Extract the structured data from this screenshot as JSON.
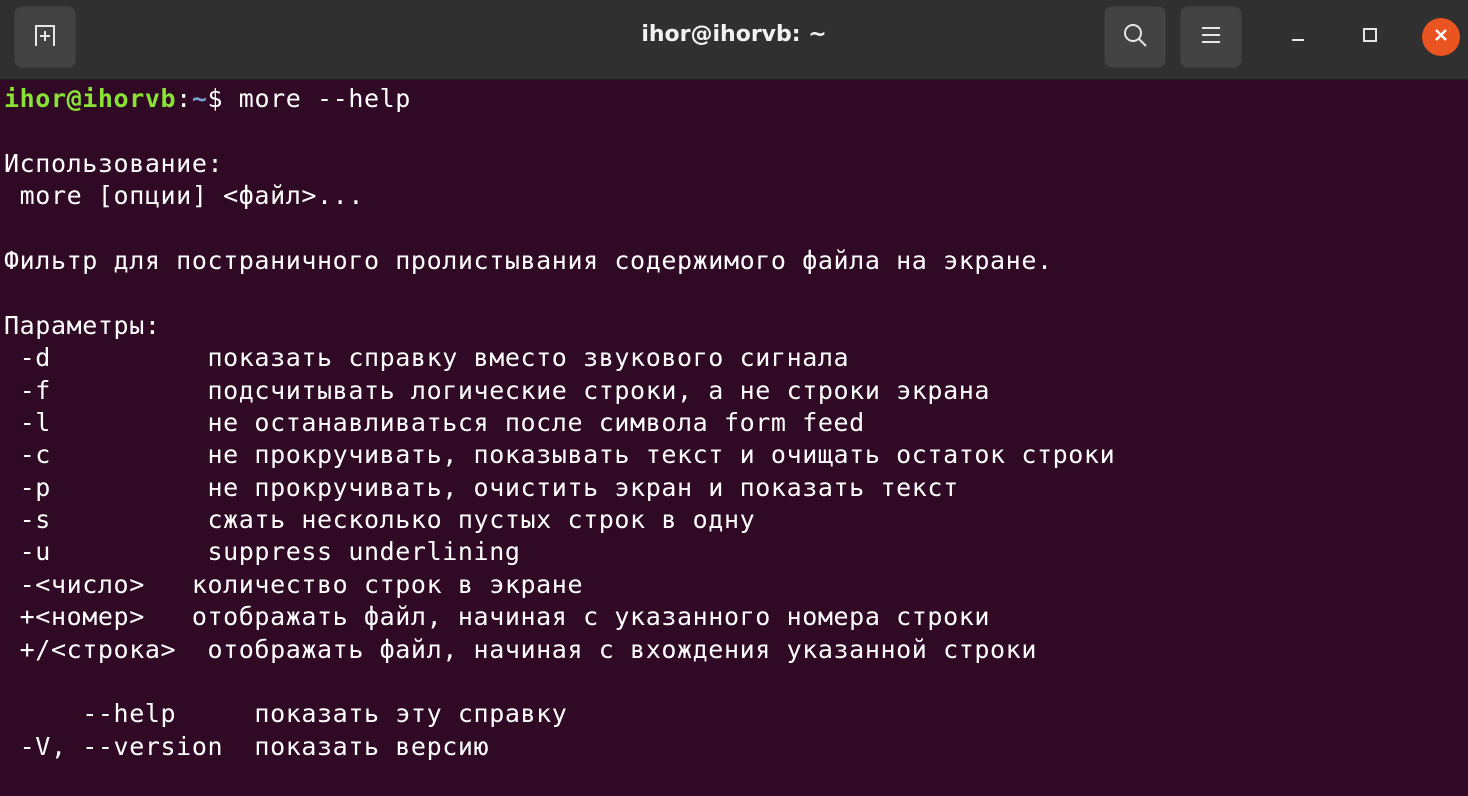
{
  "window": {
    "title": "ihor@ihorvb: ~",
    "icons": {
      "new_tab": "new-tab-icon",
      "search": "search-icon",
      "menu": "hamburger-menu-icon",
      "minimize": "minimize-icon",
      "maximize": "maximize-icon",
      "close": "close-icon"
    },
    "colors": {
      "titlebar": "#303030",
      "terminal_bg": "#300a24",
      "prompt_user": "#8ae234",
      "prompt_path": "#729fcf",
      "close_button": "#e95420"
    }
  },
  "terminal": {
    "prompt": {
      "user": "ihor@ihorvb",
      "separator": ":",
      "path": "~",
      "symbol": "$ ",
      "command": "more --help"
    },
    "lines": [
      "",
      "Использование:",
      " more [опции] <файл>...",
      "",
      "Фильтр для постраничного пролистывания содержимого файла на экране.",
      "",
      "Параметры:",
      " -d          показать справку вместо звукового сигнала",
      " -f          подсчитывать логические строки, а не строки экрана",
      " -l          не останавливаться после символа form feed",
      " -c          не прокручивать, показывать текст и очищать остаток строки",
      " -p          не прокручивать, очистить экран и показать текст",
      " -s          сжать несколько пустых строк в одну",
      " -u          suppress underlining",
      " -<число>   количество строк в экране",
      " +<номер>   отображать файл, начиная с указанного номера строки",
      " +/<строка>  отображать файл, начиная с вхождения указанной строки",
      "",
      "     --help     показать эту справку",
      " -V, --version  показать версию"
    ]
  }
}
